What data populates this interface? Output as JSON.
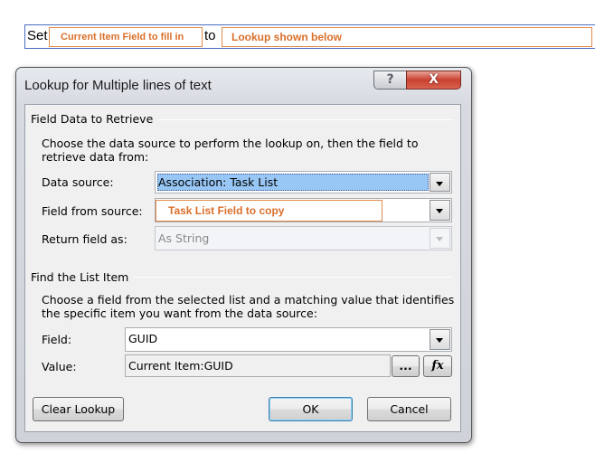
{
  "set_bar": {
    "set_label": "Set",
    "field_placeholder": "Current Item Field to fill in",
    "to_label": "to",
    "value_placeholder": "Lookup shown below"
  },
  "dialog": {
    "title": "Lookup for Multiple lines of text",
    "help_glyph": "?",
    "close_glyph": "X",
    "field_data_section": {
      "heading": "Field Data to Retrieve",
      "description": "Choose the data source to perform the lookup on, then the field to retrieve data from:",
      "data_source_label": "Data source:",
      "data_source_value": "Association: Task List",
      "field_from_source_label": "Field from source:",
      "field_from_source_value": "Task List Field to copy",
      "return_field_label": "Return field as:",
      "return_field_value": "As String"
    },
    "find_item_section": {
      "heading": "Find the List Item",
      "description": "Choose a field from the selected list and a matching value that identifies the specific item you want from the data source:",
      "field_label": "Field:",
      "field_value": "GUID",
      "value_label": "Value:",
      "value_value": "Current Item:GUID",
      "browse_label": "...",
      "formula_label": "fx"
    },
    "buttons": {
      "clear": "Clear Lookup",
      "ok": "OK",
      "cancel": "Cancel"
    }
  },
  "colors": {
    "highlight_orange": "#d96f2a",
    "selection_blue": "#98c7f5",
    "close_red": "#c8412f"
  }
}
